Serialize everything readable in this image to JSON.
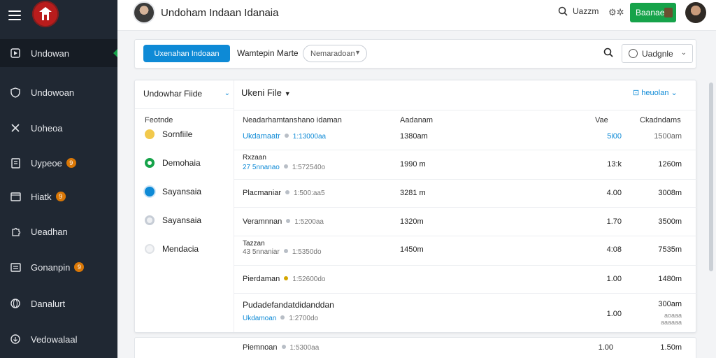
{
  "app": {
    "title": "Undoham Indaan Idanaia"
  },
  "header": {
    "search_label": "Uazzm",
    "button_label": "Baanae"
  },
  "sidebar": {
    "items": [
      {
        "label": "Undowan",
        "icon": "play-square-icon",
        "badge": ""
      },
      {
        "label": "Undowoan",
        "icon": "shield-icon",
        "badge": ""
      },
      {
        "label": "Uoheoa",
        "icon": "tools-icon",
        "badge": ""
      },
      {
        "label": "Uypeoe",
        "icon": "document-icon",
        "badge": "9"
      },
      {
        "label": "Hiatk",
        "icon": "window-icon",
        "badge": "9"
      },
      {
        "label": "Ueadhan",
        "icon": "puzzle-icon",
        "badge": ""
      },
      {
        "label": "Gonanpin",
        "icon": "list-window-icon",
        "badge": "9"
      },
      {
        "label": "Danalurt",
        "icon": "globe-icon",
        "badge": ""
      },
      {
        "label": "Vedowalaal",
        "icon": "circle-arrow-icon",
        "badge": ""
      }
    ]
  },
  "toolbar": {
    "primary_label": "Uxenahan Indoaan",
    "label": "Wamtepin Marte",
    "select_value": "Nemaradoan",
    "dropdown_value": "Uadgnle"
  },
  "filters": {
    "header": "Undowhar Fiide",
    "section_label": "Feotnde",
    "items": [
      {
        "label": "Sornfiile",
        "color": "#f2c94c"
      },
      {
        "label": "Demohaia",
        "color": "#16a34a"
      },
      {
        "label": "Sayansaia",
        "color": "#0e8ad6"
      },
      {
        "label": "Sayansaia",
        "color": "#c7cdd6"
      },
      {
        "label": "Mendacia",
        "color": "#dfe2e6"
      }
    ]
  },
  "grid": {
    "title": "Ukeni File",
    "right_link": "heuolan",
    "columns": {
      "name": "Neadarhamtanshano idaman",
      "size": "Aadanam",
      "value": "Vae",
      "downloads": "Ckadndams"
    },
    "rows": [
      {
        "name": "Ukdamaatr",
        "name_blue": true,
        "sub_name": "",
        "time": "1:13000aa",
        "size": "1380am",
        "value": "5i00",
        "value_blue": true,
        "downloads": "1500am",
        "note": ""
      },
      {
        "name": "Rxzaan",
        "name_blue": false,
        "sub_name": "27 5nnanao",
        "time": "1:572540o",
        "size": "1990 m",
        "value": "13:k",
        "value_blue": false,
        "downloads": "1260m",
        "note": ""
      },
      {
        "name": "Placmaniar",
        "name_blue": false,
        "sub_name": "",
        "time": "1:500:aa5",
        "size": "3281 m",
        "value": "4.00",
        "value_blue": false,
        "downloads": "3008m",
        "note": ""
      },
      {
        "name": "Veramnnan",
        "name_blue": false,
        "sub_name": "",
        "time": "1:5200aa",
        "size": "1320m",
        "value": "1.70",
        "value_blue": false,
        "downloads": "3500m",
        "note": ""
      },
      {
        "name": "Tazzan",
        "name_blue": false,
        "sub_name": "43 5nnaniar",
        "time": "1:5350do",
        "size": "1450m",
        "value": "4:08",
        "value_blue": false,
        "downloads": "7535m",
        "note": ""
      },
      {
        "name": "Pierdaman",
        "name_blue": false,
        "sub_name": "",
        "time": "1:52600do",
        "size": "",
        "value": "1.00",
        "value_blue": false,
        "downloads": "1480m",
        "note": ""
      },
      {
        "name": "Pudadefandatdidanddan",
        "name_blue": false,
        "sub_name": "Ukdamoan",
        "time": "1:2700do",
        "size": "",
        "value": "1.00",
        "value_blue": false,
        "downloads": "300am",
        "note": "aoaaa aaaaaa"
      }
    ],
    "partial_row": {
      "name": "Piemnoan",
      "time": "1:5300aa",
      "value": "1.00",
      "downloads": "1.50m"
    }
  }
}
